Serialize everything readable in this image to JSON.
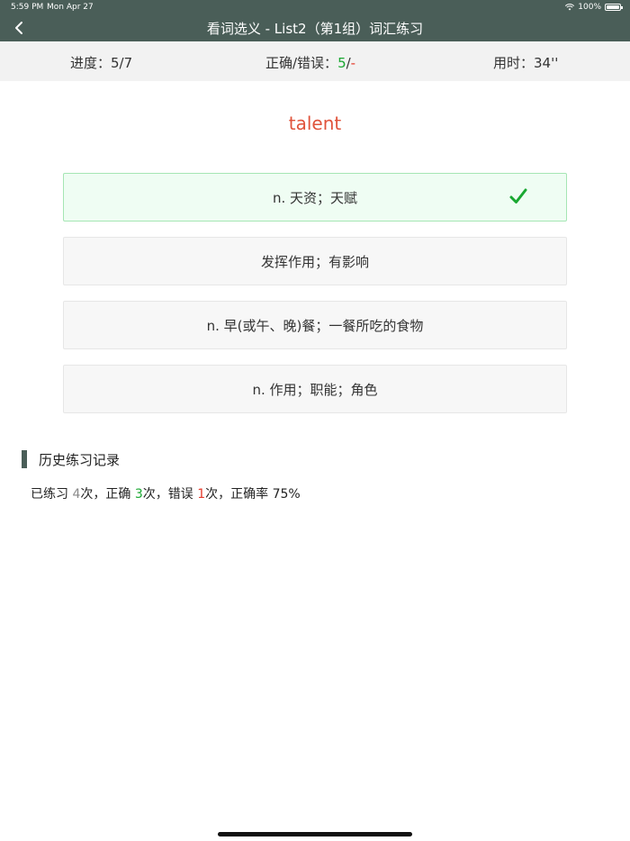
{
  "status_bar": {
    "time": "5:59 PM",
    "date": "Mon Apr 27",
    "battery": "100%",
    "icons": [
      "wifi-icon",
      "battery-icon"
    ]
  },
  "nav": {
    "title": "看词选义 - List2（第1组）词汇练习",
    "back_icon": "chevron-left-icon"
  },
  "progress": {
    "progress_label": "进度：",
    "progress_value": "5/7",
    "score_label": "正确/错误：",
    "correct": "5",
    "separator": "/",
    "wrong": "-",
    "time_label": "用时：",
    "time_value": "34''"
  },
  "question": {
    "word": "talent"
  },
  "options": [
    {
      "text": "n. 天资；天赋",
      "state": "correct",
      "icon": "checkmark-icon"
    },
    {
      "text": "发挥作用；有影响",
      "state": "normal"
    },
    {
      "text": "n. 早(或午、晚)餐；一餐所吃的食物",
      "state": "normal"
    },
    {
      "text": "n. 作用；职能；角色",
      "state": "normal"
    }
  ],
  "history": {
    "heading": "历史练习记录",
    "prefix": "已练习 ",
    "practiced": "4",
    "practiced_suffix": "次，正确 ",
    "correct": "3",
    "correct_suffix": "次，错误 ",
    "wrong": "1",
    "wrong_suffix": "次，正确率 ",
    "rate": "75%"
  },
  "colors": {
    "header_bg": "#4a5e58",
    "accent_red": "#e0533b",
    "correct_green": "#1aa832",
    "correct_bg": "#effdf3"
  }
}
